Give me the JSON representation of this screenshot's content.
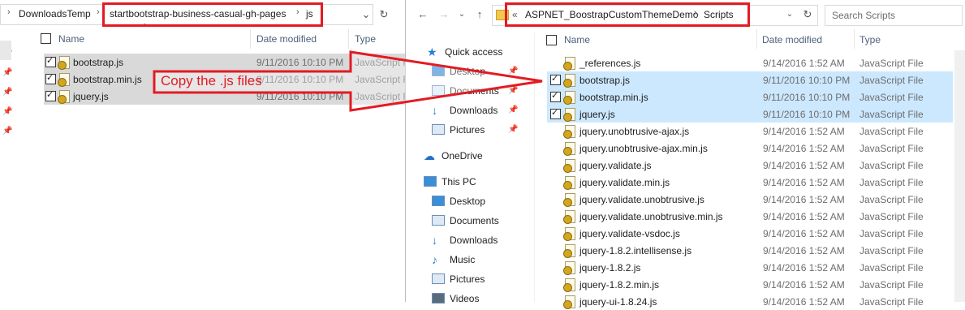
{
  "left_window": {
    "breadcrumb": [
      "DownloadsTemp",
      "startbootstrap-business-casual-gh-pages",
      "js"
    ],
    "headers": {
      "name": "Name",
      "date": "Date modified",
      "type": "Type"
    },
    "files": [
      {
        "name": "bootstrap.js",
        "date": "9/11/2016 10:10 PM",
        "type": "JavaScript Fi"
      },
      {
        "name": "bootstrap.min.js",
        "date": "9/11/2016 10:10 PM",
        "type": "JavaScript Fi"
      },
      {
        "name": "jquery.js",
        "date": "9/11/2016 10:10 PM",
        "type": "JavaScript Fi"
      }
    ]
  },
  "annotation": {
    "text": "Copy the .js files",
    "color": "#e21b23"
  },
  "right_window": {
    "breadcrumb_prefix": "«",
    "breadcrumb": [
      "ASPNET_BoostrapCustomThemeDemo",
      "Scripts"
    ],
    "search_placeholder": "Search Scripts",
    "headers": {
      "name": "Name",
      "date": "Date modified",
      "type": "Type"
    },
    "nav": [
      {
        "label": "Quick access",
        "icon": "star-icon"
      },
      {
        "label": "Desktop",
        "icon": "desktop-icon"
      },
      {
        "label": "Documents",
        "icon": "documents-icon"
      },
      {
        "label": "Downloads",
        "icon": "download-icon"
      },
      {
        "label": "Pictures",
        "icon": "pictures-icon"
      },
      {
        "label": "OneDrive",
        "icon": "cloud-icon"
      },
      {
        "label": "This PC",
        "icon": "pc-icon"
      },
      {
        "label": "Desktop",
        "icon": "desktop-icon"
      },
      {
        "label": "Documents",
        "icon": "documents-icon"
      },
      {
        "label": "Downloads",
        "icon": "download-icon"
      },
      {
        "label": "Music",
        "icon": "music-icon"
      },
      {
        "label": "Pictures",
        "icon": "pictures-icon"
      },
      {
        "label": "Videos",
        "icon": "videos-icon"
      }
    ],
    "files": [
      {
        "name": "_references.js",
        "date": "9/14/2016 1:52 AM",
        "type": "JavaScript File",
        "selected": false
      },
      {
        "name": "bootstrap.js",
        "date": "9/11/2016 10:10 PM",
        "type": "JavaScript File",
        "selected": true
      },
      {
        "name": "bootstrap.min.js",
        "date": "9/11/2016 10:10 PM",
        "type": "JavaScript File",
        "selected": true
      },
      {
        "name": "jquery.js",
        "date": "9/11/2016 10:10 PM",
        "type": "JavaScript File",
        "selected": true
      },
      {
        "name": "jquery.unobtrusive-ajax.js",
        "date": "9/14/2016 1:52 AM",
        "type": "JavaScript File",
        "selected": false
      },
      {
        "name": "jquery.unobtrusive-ajax.min.js",
        "date": "9/14/2016 1:52 AM",
        "type": "JavaScript File",
        "selected": false
      },
      {
        "name": "jquery.validate.js",
        "date": "9/14/2016 1:52 AM",
        "type": "JavaScript File",
        "selected": false
      },
      {
        "name": "jquery.validate.min.js",
        "date": "9/14/2016 1:52 AM",
        "type": "JavaScript File",
        "selected": false
      },
      {
        "name": "jquery.validate.unobtrusive.js",
        "date": "9/14/2016 1:52 AM",
        "type": "JavaScript File",
        "selected": false
      },
      {
        "name": "jquery.validate.unobtrusive.min.js",
        "date": "9/14/2016 1:52 AM",
        "type": "JavaScript File",
        "selected": false
      },
      {
        "name": "jquery.validate-vsdoc.js",
        "date": "9/14/2016 1:52 AM",
        "type": "JavaScript File",
        "selected": false
      },
      {
        "name": "jquery-1.8.2.intellisense.js",
        "date": "9/14/2016 1:52 AM",
        "type": "JavaScript File",
        "selected": false
      },
      {
        "name": "jquery-1.8.2.js",
        "date": "9/14/2016 1:52 AM",
        "type": "JavaScript File",
        "selected": false
      },
      {
        "name": "jquery-1.8.2.min.js",
        "date": "9/14/2016 1:52 AM",
        "type": "JavaScript File",
        "selected": false
      },
      {
        "name": "jquery-ui-1.8.24.js",
        "date": "9/14/2016 1:52 AM",
        "type": "JavaScript File",
        "selected": false
      }
    ]
  }
}
